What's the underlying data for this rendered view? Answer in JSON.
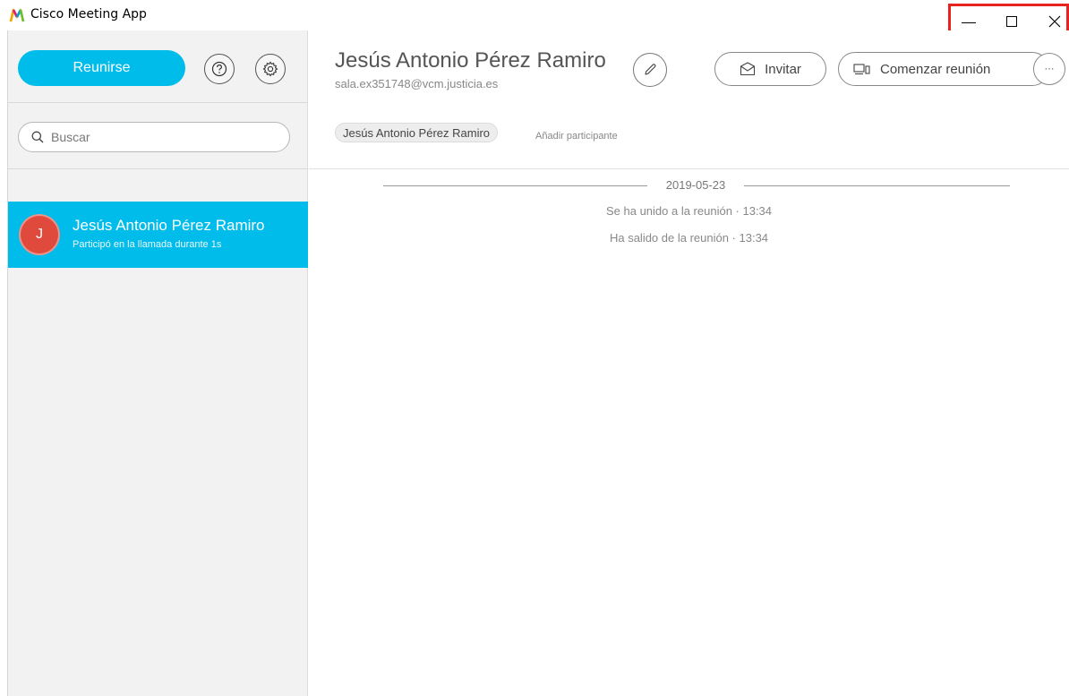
{
  "window": {
    "title": "Cisco Meeting App",
    "logo_icon": "cisco-meeting-m-logo",
    "controls": {
      "minimize": "minimize-icon",
      "maximize": "maximize-icon",
      "close": "close-icon",
      "highlight_color": "#e8231e"
    }
  },
  "sidebar": {
    "join_label": "Reunirse",
    "help_icon": "help-icon",
    "settings_icon": "gear-icon",
    "search_placeholder": "Buscar",
    "contacts": [
      {
        "initial": "J",
        "name": "Jesús Antonio Pérez Ramiro",
        "subtitle": "Participó en la llamada durante 1s",
        "selected": true
      }
    ]
  },
  "main": {
    "title": "Jesús Antonio Pérez Ramiro",
    "email": "sala.ex351748@vcm.justicia.es",
    "invite_label": "Invitar",
    "start_meeting_label": "Comenzar reunión",
    "more_label": "···",
    "participants": [
      "Jesús Antonio Pérez Ramiro"
    ],
    "add_participant_label": "Añadir participante",
    "history": {
      "date": "2019-05-23",
      "events": [
        {
          "text": "Se ha unido a la reunión · 13:34"
        },
        {
          "text": "Ha salido de la reunión · 13:34"
        }
      ]
    }
  },
  "colors": {
    "accent": "#00bceb",
    "avatar": "#e04a3c",
    "sidebar_bg": "#f2f2f2"
  }
}
